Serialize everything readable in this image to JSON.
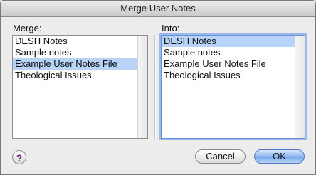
{
  "dialog": {
    "title": "Merge User Notes"
  },
  "merge": {
    "label": "Merge:",
    "items": [
      "DESH Notes",
      "Sample notes",
      "Example User Notes File",
      "Theological Issues"
    ],
    "selected_index": 2
  },
  "into": {
    "label": "Into:",
    "items": [
      "DESH Notes",
      "Sample notes",
      "Example User Notes File",
      "Theological Issues"
    ],
    "selected_index": 0
  },
  "buttons": {
    "help": "?",
    "cancel": "Cancel",
    "ok": "OK"
  }
}
